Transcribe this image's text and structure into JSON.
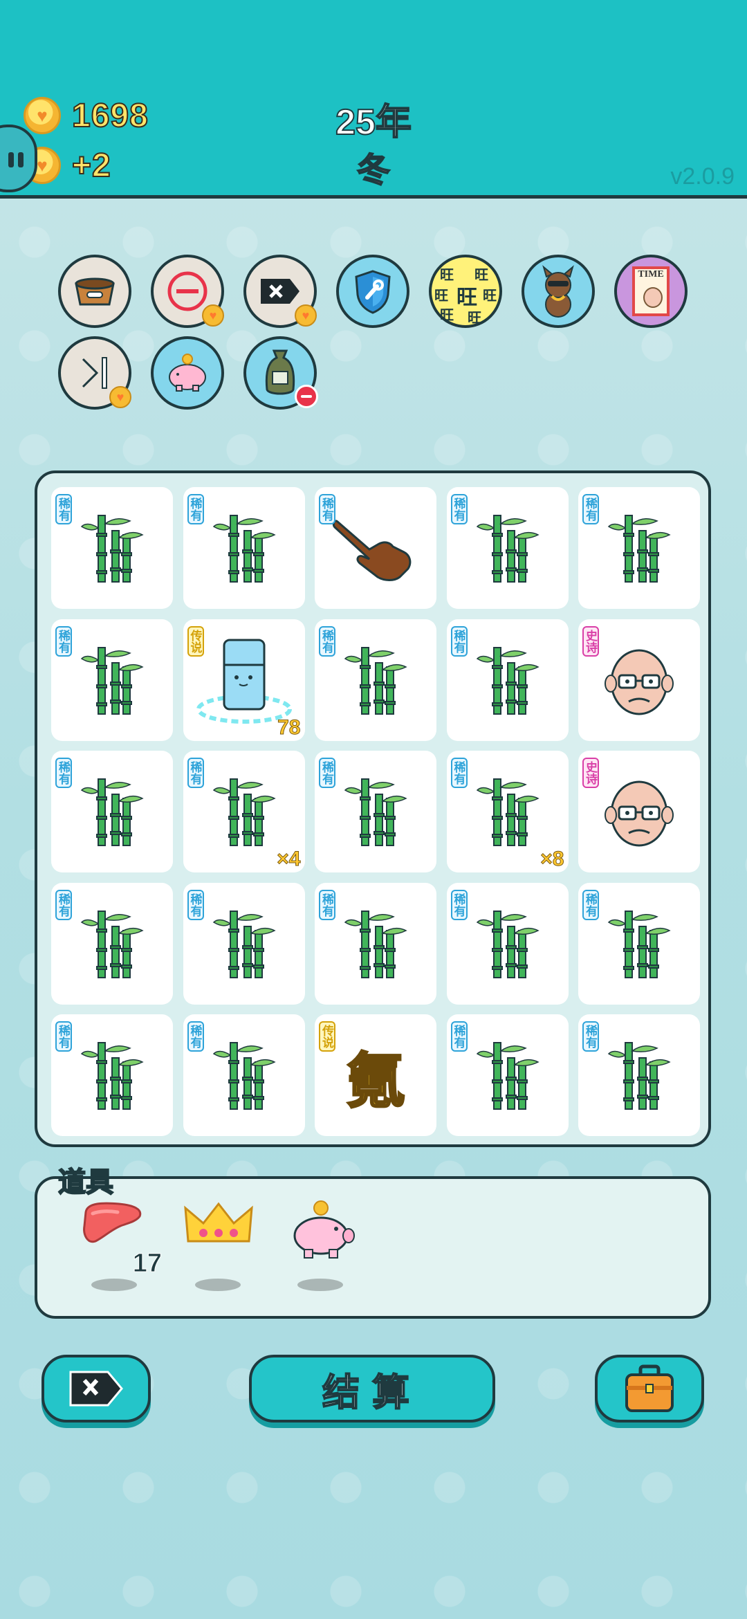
{
  "header": {
    "coins": "1698",
    "income": "+2",
    "year": "25年",
    "season": "冬",
    "version": "v2.0.9",
    "colors": {
      "bar": "#1dc1c4",
      "coin_text": "#ffe46a",
      "season": "#ff4f6a"
    }
  },
  "effects": [
    {
      "icon": "pet-food-bowl-icon",
      "has_heart_badge": false
    },
    {
      "icon": "remove-circle-icon",
      "has_heart_badge": true
    },
    {
      "icon": "delete-tag-icon",
      "has_heart_badge": true
    },
    {
      "icon": "shield-wrench-icon",
      "has_heart_badge": false
    },
    {
      "icon": "wang-text-icon",
      "glyph_big": "旺",
      "glyph_small": "旺",
      "has_heart_badge": false
    },
    {
      "icon": "cool-dog-icon",
      "has_heart_badge": false
    },
    {
      "icon": "time-magazine-icon",
      "label": "TIME",
      "has_heart_badge": false
    },
    {
      "icon": "skip-icon",
      "has_heart_badge": true
    },
    {
      "icon": "piggy-bank-icon",
      "has_heart_badge": false
    },
    {
      "icon": "money-sack-icon",
      "has_minus_badge": true
    }
  ],
  "board": {
    "rows": 5,
    "cols": 5,
    "cells": [
      {
        "symbol": "bamboo",
        "rarity": "稀有"
      },
      {
        "symbol": "bamboo",
        "rarity": "稀有"
      },
      {
        "symbol": "pointing-hand",
        "rarity": "稀有"
      },
      {
        "symbol": "bamboo",
        "rarity": "稀有"
      },
      {
        "symbol": "bamboo",
        "rarity": "稀有"
      },
      {
        "symbol": "bamboo",
        "rarity": "稀有"
      },
      {
        "symbol": "fridge",
        "rarity": "传说",
        "counter": "78"
      },
      {
        "symbol": "bamboo",
        "rarity": "稀有"
      },
      {
        "symbol": "bamboo",
        "rarity": "稀有"
      },
      {
        "symbol": "old-man",
        "rarity": "史诗"
      },
      {
        "symbol": "bamboo",
        "rarity": "稀有"
      },
      {
        "symbol": "bamboo",
        "rarity": "稀有",
        "counter": "×4"
      },
      {
        "symbol": "bamboo",
        "rarity": "稀有"
      },
      {
        "symbol": "bamboo",
        "rarity": "稀有",
        "counter": "×8"
      },
      {
        "symbol": "old-man",
        "rarity": "史诗"
      },
      {
        "symbol": "bamboo",
        "rarity": "稀有"
      },
      {
        "symbol": "bamboo",
        "rarity": "稀有"
      },
      {
        "symbol": "bamboo",
        "rarity": "稀有"
      },
      {
        "symbol": "bamboo",
        "rarity": "稀有"
      },
      {
        "symbol": "bamboo",
        "rarity": "稀有"
      },
      {
        "symbol": "bamboo",
        "rarity": "稀有"
      },
      {
        "symbol": "bamboo",
        "rarity": "稀有"
      },
      {
        "symbol": "ling-character",
        "rarity": "传说",
        "text": "氪"
      },
      {
        "symbol": "bamboo",
        "rarity": "稀有"
      },
      {
        "symbol": "bamboo",
        "rarity": "稀有"
      }
    ]
  },
  "items": {
    "title": "道具",
    "list": [
      {
        "icon": "liver-icon",
        "count": "17"
      },
      {
        "icon": "crown-icon",
        "count": ""
      },
      {
        "icon": "piggy-bank-icon",
        "count": ""
      }
    ]
  },
  "buttons": {
    "settle_label": "结算",
    "remove_icon": "delete-tag-icon",
    "bag_icon": "briefcase-icon"
  }
}
